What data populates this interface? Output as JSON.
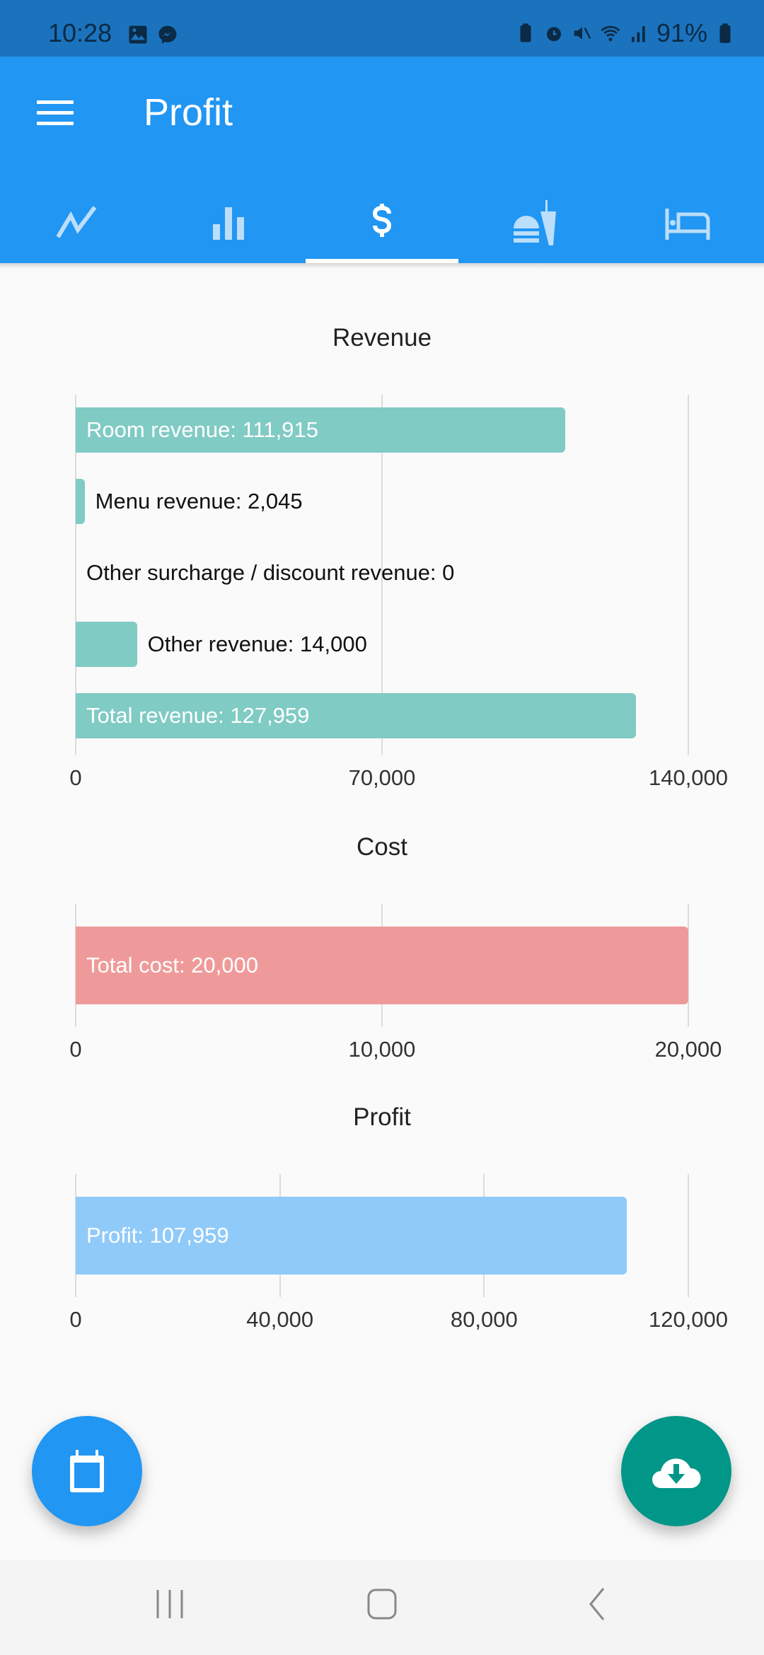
{
  "status_bar": {
    "time": "10:28",
    "left_icons": [
      "gallery-icon",
      "messenger-icon"
    ],
    "right_icons": [
      "battery-saver-icon",
      "alarm-icon",
      "mute-icon",
      "wifi-icon",
      "signal-icon"
    ],
    "battery": "91%"
  },
  "app_bar": {
    "title": "Profit",
    "tabs": [
      {
        "icon": "trending-line-icon",
        "active": false
      },
      {
        "icon": "bar-chart-icon",
        "active": false
      },
      {
        "icon": "dollar-icon",
        "active": true
      },
      {
        "icon": "food-drink-icon",
        "active": false
      },
      {
        "icon": "bed-icon",
        "active": false
      }
    ]
  },
  "colors": {
    "primary": "#2196f3",
    "status_bar": "#1b73bd",
    "revenue_bar": "#80cbc4",
    "cost_bar": "#ef9a9a",
    "profit_bar": "#90caf9",
    "download_fab": "#009688"
  },
  "chart_data": [
    {
      "type": "bar",
      "orientation": "horizontal",
      "title": "Revenue",
      "categories": [
        "Room revenue",
        "Menu revenue",
        "Other surcharge / discount revenue",
        "Other revenue",
        "Total revenue"
      ],
      "values": [
        111915,
        2045,
        0,
        14000,
        127959
      ],
      "labels": [
        "Room revenue: 111,915",
        "Menu revenue: 2,045",
        "Other surcharge / discount revenue: 0",
        "Other revenue: 14,000",
        "Total revenue: 127,959"
      ],
      "xlim": [
        0,
        140000
      ],
      "ticks": [
        0,
        70000,
        140000
      ],
      "tick_labels": [
        "0",
        "70,000",
        "140,000"
      ],
      "grid": true
    },
    {
      "type": "bar",
      "orientation": "horizontal",
      "title": "Cost",
      "categories": [
        "Total cost"
      ],
      "values": [
        20000
      ],
      "labels": [
        "Total cost: 20,000"
      ],
      "xlim": [
        0,
        20000
      ],
      "ticks": [
        0,
        10000,
        20000
      ],
      "tick_labels": [
        "0",
        "10,000",
        "20,000"
      ],
      "grid": true
    },
    {
      "type": "bar",
      "orientation": "horizontal",
      "title": "Profit",
      "categories": [
        "Profit"
      ],
      "values": [
        107959
      ],
      "labels": [
        "Profit: 107,959"
      ],
      "xlim": [
        0,
        120000
      ],
      "ticks": [
        0,
        40000,
        80000,
        120000
      ],
      "tick_labels": [
        "0",
        "40,000",
        "80,000",
        "120,000"
      ],
      "grid": true
    }
  ],
  "fabs": {
    "left": "calendar-icon",
    "right": "cloud-download-icon"
  },
  "nav_bar": [
    "recent-apps-icon",
    "home-icon",
    "back-icon"
  ]
}
